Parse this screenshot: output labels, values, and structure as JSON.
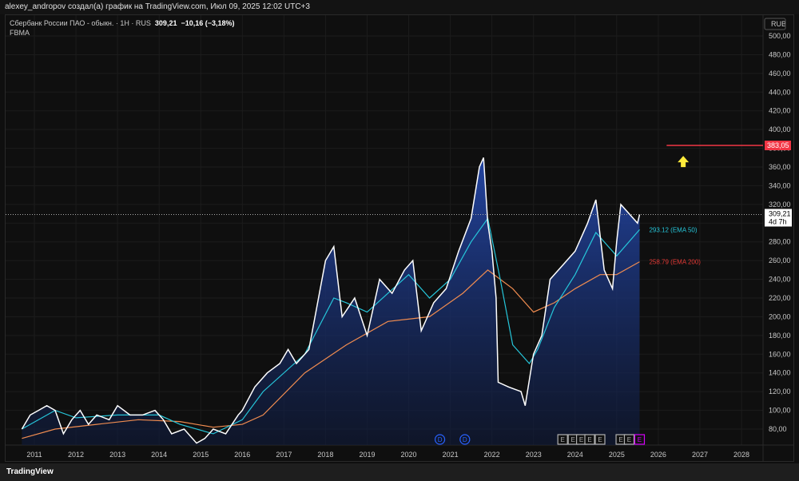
{
  "header": {
    "text": "alexey_andropov создал(а) график на TradingView.com, Июл 09, 2025 12:02 UTC+3"
  },
  "legend": {
    "symbol": "Сбербанк России ПАО - обыкн. · 1H · RUS",
    "price": "309,21",
    "change": "−10,16 (−3,18%)",
    "exchange": "FBMA"
  },
  "footer": {
    "logo": "TradingView"
  },
  "colors": {
    "price": "#ffffff",
    "fill": "#1e3a8a",
    "ema50": "#26c6da",
    "ema200": "#f08c50",
    "target": "#f23645",
    "arrow": "#ffeb3b",
    "earn_e": "#b0b0b0",
    "earn_last": "#d500f9",
    "div": "#2962ff"
  },
  "chart_data": {
    "type": "area",
    "currency": "RUB",
    "xlim": [
      2010.65,
      2028.6
    ],
    "ylim": [
      65,
      505
    ],
    "yticks": [
      80,
      100,
      120,
      140,
      160,
      180,
      200,
      220,
      240,
      260,
      280,
      300,
      320,
      340,
      360,
      380,
      400,
      420,
      440,
      460,
      480,
      500
    ],
    "ytick_labels": [
      "80,00",
      "100,00",
      "120,00",
      "140,00",
      "160,00",
      "180,00",
      "200,00",
      "220,00",
      "240,00",
      "260,00",
      "280,00",
      "300,00",
      "320,00",
      "340,00",
      "360,00",
      "380,00",
      "400,00",
      "420,00",
      "440,00",
      "460,00",
      "480,00",
      "500,00"
    ],
    "xticks": [
      "2011",
      "2012",
      "2013",
      "2014",
      "2015",
      "2016",
      "2017",
      "2018",
      "2019",
      "2020",
      "2021",
      "2022",
      "2023",
      "2024",
      "2025",
      "2026",
      "2027",
      "2028"
    ],
    "price": [
      [
        2010.7,
        80
      ],
      [
        2010.9,
        95
      ],
      [
        2011.1,
        100
      ],
      [
        2011.3,
        105
      ],
      [
        2011.5,
        100
      ],
      [
        2011.7,
        75
      ],
      [
        2011.9,
        90
      ],
      [
        2012.1,
        100
      ],
      [
        2012.3,
        85
      ],
      [
        2012.5,
        95
      ],
      [
        2012.8,
        90
      ],
      [
        2013.0,
        105
      ],
      [
        2013.3,
        95
      ],
      [
        2013.6,
        95
      ],
      [
        2013.9,
        100
      ],
      [
        2014.1,
        90
      ],
      [
        2014.3,
        75
      ],
      [
        2014.6,
        80
      ],
      [
        2014.9,
        65
      ],
      [
        2015.1,
        70
      ],
      [
        2015.3,
        80
      ],
      [
        2015.6,
        75
      ],
      [
        2015.9,
        95
      ],
      [
        2016.0,
        100
      ],
      [
        2016.3,
        125
      ],
      [
        2016.6,
        140
      ],
      [
        2016.9,
        150
      ],
      [
        2017.1,
        165
      ],
      [
        2017.3,
        150
      ],
      [
        2017.6,
        165
      ],
      [
        2018.0,
        260
      ],
      [
        2018.2,
        275
      ],
      [
        2018.4,
        200
      ],
      [
        2018.7,
        220
      ],
      [
        2019.0,
        180
      ],
      [
        2019.3,
        240
      ],
      [
        2019.6,
        225
      ],
      [
        2019.9,
        250
      ],
      [
        2020.1,
        260
      ],
      [
        2020.3,
        185
      ],
      [
        2020.6,
        215
      ],
      [
        2020.9,
        230
      ],
      [
        2021.2,
        270
      ],
      [
        2021.5,
        305
      ],
      [
        2021.7,
        360
      ],
      [
        2021.8,
        370
      ],
      [
        2021.9,
        300
      ],
      [
        2022.0,
        270
      ],
      [
        2022.1,
        220
      ],
      [
        2022.15,
        130
      ],
      [
        2022.4,
        125
      ],
      [
        2022.7,
        120
      ],
      [
        2022.8,
        105
      ],
      [
        2023.0,
        160
      ],
      [
        2023.2,
        180
      ],
      [
        2023.4,
        240
      ],
      [
        2023.7,
        255
      ],
      [
        2024.0,
        270
      ],
      [
        2024.3,
        300
      ],
      [
        2024.5,
        325
      ],
      [
        2024.7,
        250
      ],
      [
        2024.8,
        240
      ],
      [
        2024.9,
        230
      ],
      [
        2025.0,
        280
      ],
      [
        2025.1,
        320
      ],
      [
        2025.3,
        310
      ],
      [
        2025.5,
        300
      ],
      [
        2025.55,
        309.21
      ]
    ],
    "ema50": [
      [
        2010.7,
        80
      ],
      [
        2011.5,
        100
      ],
      [
        2012,
        92
      ],
      [
        2013,
        95
      ],
      [
        2014,
        95
      ],
      [
        2014.5,
        85
      ],
      [
        2015.3,
        75
      ],
      [
        2016,
        90
      ],
      [
        2016.5,
        120
      ],
      [
        2017.5,
        160
      ],
      [
        2018.2,
        220
      ],
      [
        2018.5,
        215
      ],
      [
        2019,
        205
      ],
      [
        2019.5,
        225
      ],
      [
        2020,
        245
      ],
      [
        2020.5,
        220
      ],
      [
        2021,
        240
      ],
      [
        2021.5,
        280
      ],
      [
        2021.9,
        305
      ],
      [
        2022.2,
        240
      ],
      [
        2022.5,
        170
      ],
      [
        2022.9,
        150
      ],
      [
        2023.1,
        165
      ],
      [
        2023.5,
        210
      ],
      [
        2024,
        245
      ],
      [
        2024.5,
        290
      ],
      [
        2024.8,
        275
      ],
      [
        2025,
        265
      ],
      [
        2025.55,
        293.12
      ]
    ],
    "ema200": [
      [
        2010.7,
        70
      ],
      [
        2011.5,
        80
      ],
      [
        2012.5,
        85
      ],
      [
        2013.5,
        90
      ],
      [
        2014.5,
        88
      ],
      [
        2015.3,
        82
      ],
      [
        2016,
        85
      ],
      [
        2016.5,
        95
      ],
      [
        2017.5,
        140
      ],
      [
        2018.5,
        170
      ],
      [
        2019.5,
        195
      ],
      [
        2020.5,
        200
      ],
      [
        2021.3,
        225
      ],
      [
        2021.9,
        250
      ],
      [
        2022.5,
        230
      ],
      [
        2023,
        205
      ],
      [
        2023.5,
        215
      ],
      [
        2024,
        230
      ],
      [
        2024.6,
        245
      ],
      [
        2025,
        245
      ],
      [
        2025.55,
        258.79
      ]
    ],
    "last_price_label": "309,21",
    "countdown": "4d 7h",
    "ema50_label": "293.12 (EMA 50)",
    "ema200_label": "258.79 (EMA 200)",
    "target": {
      "value": 383.05,
      "label": "383,05",
      "from_x": 2026.2
    },
    "arrow": {
      "x": 2026.6,
      "y": 365
    },
    "dividends": [
      {
        "x": 2020.75,
        "label": "D"
      },
      {
        "x": 2021.35,
        "label": "D"
      }
    ],
    "earnings": [
      {
        "x": 2023.7,
        "label": "E"
      },
      {
        "x": 2023.95,
        "label": "E"
      },
      {
        "x": 2024.15,
        "label": "E"
      },
      {
        "x": 2024.35,
        "label": "E"
      },
      {
        "x": 2024.6,
        "label": "E"
      },
      {
        "x": 2025.1,
        "label": "E"
      },
      {
        "x": 2025.3,
        "label": "E"
      },
      {
        "x": 2025.55,
        "label": "E",
        "last": true
      }
    ]
  }
}
